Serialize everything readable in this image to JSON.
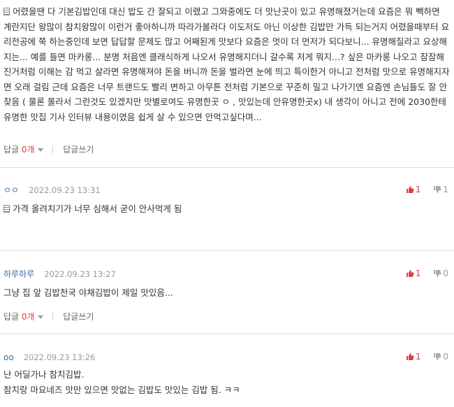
{
  "comments": [
    {
      "text": "어렸을땐 다 기본김밥인데 대신 밥도 간 잘되고 이랬고 그와중에도 더 맛난곳이 있고 유명해졌거는데 요즘은 뭐 빽하면 계란지단 왕많이 참치왕많이 이런거 좋아하니까 따라가볼라다 이도저도 아닌 이상한 김밥만 가득 되는거지 어렸을때부터 요리전공에 쭉 하는중인데 보면 답답할 문제도 많고 어째된게 맛보다 요즘은 멋이 더 먼저가 되다보니... 유명해질라고 요상해지는... 예를 들면 마카롱... 분명 처음엔 클래식하게 나오서 유명해지더니 갈수록 저게 뭐지...? 싶은 마카롱 나오고 잠잠해진거처럼 이해는 감 먹고 살라면 유명해져야 돈을 버니까 돈을 벌라면 눈에 띄고 특이한거 아니고 전처럼 맛으로 유명해지자면 오래 걸림 근데 요즘은 너무 트랜드도 빨리 변하고 아무튼 전처럼 기본으로 꾸준히 밀고 나가기엔 요즘엔 손님들도 잘 안찾음 ( 물론 몰라서 그런것도 있겠지만 맛별로여도 유명한곳 ㅇ , 맛있는데 안유명한곳x) 내 생각이 아니고 전에 2030한테 유명한 맛집 기사 인터뷰 내용이였음 쉽게 살 수 있으면 안먹고싶다며...",
      "reply_label": "답글",
      "reply_count": "0개",
      "write_label": "답글쓰기"
    },
    {
      "author": "ㅇㅇ",
      "date": "2022.09.23 13:31",
      "up": "1",
      "down": "1",
      "text": "가격 올려치기가 너무 심해서 굳이 안사먹게 됨"
    },
    {
      "author": "하루하루",
      "date": "2022.09.23 13:27",
      "up": "1",
      "down": "0",
      "text": "그냥 집 앞 김밥천국 야채김밥이 제일 맛있음...",
      "reply_label": "답글",
      "reply_count": "0개",
      "write_label": "답글쓰기"
    },
    {
      "author": "oo",
      "date": "2022.09.23 13:26",
      "up": "1",
      "down": "0",
      "text_lines": [
        "난 어딜가나 참치김밥.",
        "참치랑 마요네즈 맛만 있으면 맛없는 김밥도 맛있는 김밥 됨. ㅋㅋ"
      ]
    }
  ],
  "icons": {
    "thumbs_up": "thumbs-up-icon",
    "thumbs_down": "thumbs-down-icon",
    "memo": "memo-icon"
  },
  "colors": {
    "author": "#3a6ea5",
    "up": "#e03c3c",
    "muted": "#999999"
  }
}
